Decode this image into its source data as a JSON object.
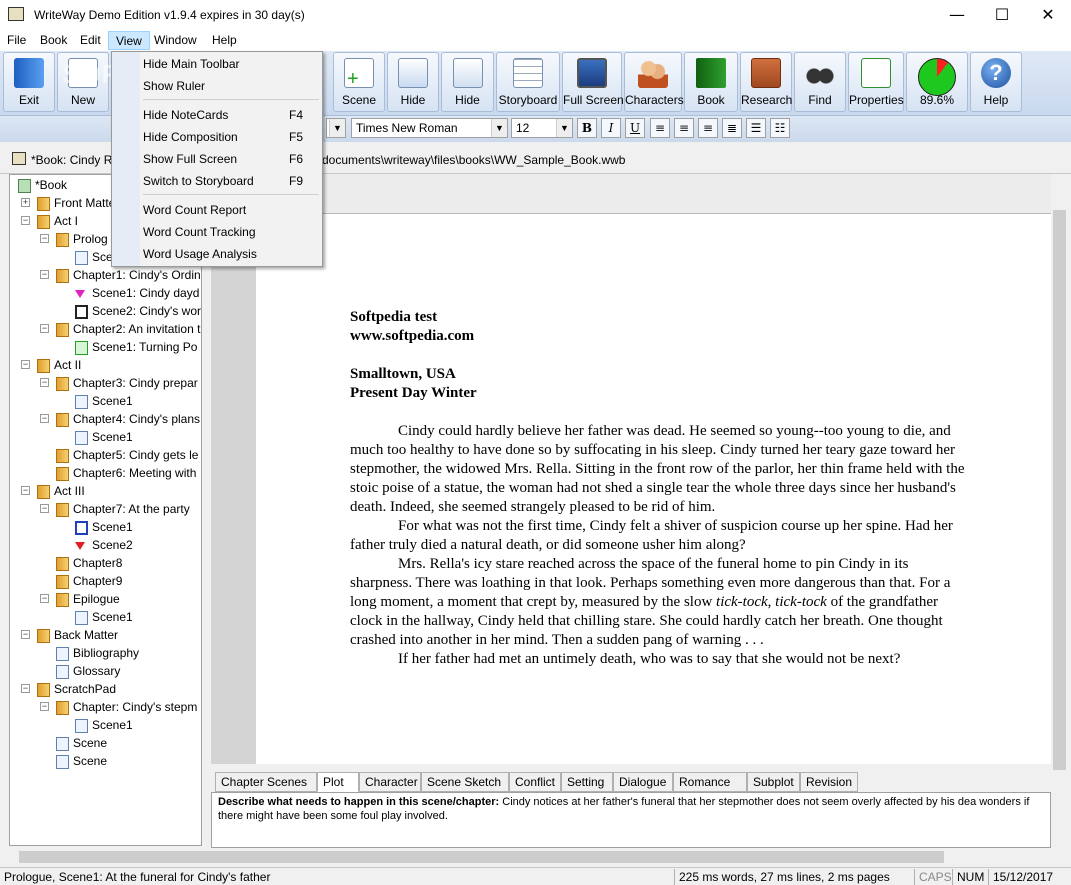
{
  "window": {
    "title": "WriteWay Demo Edition v1.9.4  expires in 30 day(s)",
    "min": "—",
    "max": "☐",
    "close": "✕"
  },
  "menubar": [
    "File",
    "Book",
    "Edit",
    "View",
    "Window",
    "Help"
  ],
  "toolbar": {
    "buttons": [
      "Exit",
      "New",
      "Scene",
      "Hide",
      "Hide",
      "Storyboard",
      "Full Screen",
      "Characters",
      "Book",
      "Research",
      "Find",
      "Properties",
      "89.6%",
      "Help"
    ],
    "watermark": "SOFTPEDIA"
  },
  "format": {
    "style": "",
    "font": "Times New Roman",
    "size": "12",
    "bold": "B",
    "italic": "I",
    "underline": "U"
  },
  "book_tab": {
    "label": "*Book: Cindy R",
    "path": "documents\\writeway\\files\\books\\WW_Sample_Book.wwb"
  },
  "view_menu": {
    "items": [
      {
        "label": "Hide Main Toolbar",
        "shortcut": ""
      },
      {
        "label": "Show Ruler",
        "shortcut": ""
      },
      {
        "label": "Hide NoteCards",
        "shortcut": "F4"
      },
      {
        "label": "Hide Composition",
        "shortcut": "F5"
      },
      {
        "label": "Show Full Screen",
        "shortcut": "F6"
      },
      {
        "label": "Switch to Storyboard",
        "shortcut": "F9"
      },
      {
        "label": "Word Count Report",
        "shortcut": ""
      },
      {
        "label": "Word Count Tracking",
        "shortcut": ""
      },
      {
        "label": "Word Usage Analysis",
        "shortcut": ""
      }
    ]
  },
  "tree": [
    {
      "label": "*Book",
      "icon": "book",
      "depth": 0
    },
    {
      "label": "Front Matte",
      "icon": "folder",
      "depth": 1,
      "exp": "+"
    },
    {
      "label": "Act I",
      "icon": "folder",
      "depth": 1,
      "exp": "−"
    },
    {
      "label": "Prolog",
      "icon": "folder",
      "depth": 2,
      "exp": "−"
    },
    {
      "label": "Sce",
      "icon": "scene",
      "depth": 3
    },
    {
      "label": "Chapter1: Cindy's Ordin",
      "icon": "folder",
      "depth": 2,
      "exp": "−"
    },
    {
      "label": "Scene1: Cindy dayd",
      "icon": "flag-magenta",
      "depth": 3
    },
    {
      "label": "Scene2: Cindy's wor",
      "icon": "scene-dark",
      "depth": 3
    },
    {
      "label": "Chapter2: An invitation t",
      "icon": "folder",
      "depth": 2,
      "exp": "−"
    },
    {
      "label": "Scene1: Turning Po",
      "icon": "scene-green",
      "depth": 3
    },
    {
      "label": "Act II",
      "icon": "folder",
      "depth": 1,
      "exp": "−"
    },
    {
      "label": "Chapter3: Cindy prepar",
      "icon": "folder",
      "depth": 2,
      "exp": "−"
    },
    {
      "label": "Scene1",
      "icon": "scene",
      "depth": 3
    },
    {
      "label": "Chapter4: Cindy's plans",
      "icon": "folder",
      "depth": 2,
      "exp": "−"
    },
    {
      "label": "Scene1",
      "icon": "scene",
      "depth": 3
    },
    {
      "label": "Chapter5: Cindy gets le",
      "icon": "folder",
      "depth": 2
    },
    {
      "label": "Chapter6: Meeting with",
      "icon": "folder",
      "depth": 2
    },
    {
      "label": "Act III",
      "icon": "folder",
      "depth": 1,
      "exp": "−"
    },
    {
      "label": "Chapter7: At the party",
      "icon": "folder",
      "depth": 2,
      "exp": "−"
    },
    {
      "label": "Scene1",
      "icon": "scene-blue",
      "depth": 3
    },
    {
      "label": "Scene2",
      "icon": "flag-red",
      "depth": 3
    },
    {
      "label": "Chapter8",
      "icon": "folder",
      "depth": 2
    },
    {
      "label": "Chapter9",
      "icon": "folder",
      "depth": 2
    },
    {
      "label": "Epilogue",
      "icon": "folder",
      "depth": 2,
      "exp": "−"
    },
    {
      "label": "Scene1",
      "icon": "scene",
      "depth": 3
    },
    {
      "label": "Back Matter",
      "icon": "folder",
      "depth": 1,
      "exp": "−"
    },
    {
      "label": "Bibliography",
      "icon": "scene",
      "depth": 2
    },
    {
      "label": "Glossary",
      "icon": "scene",
      "depth": 2
    },
    {
      "label": "ScratchPad",
      "icon": "pad",
      "depth": 1,
      "exp": "−"
    },
    {
      "label": "Chapter: Cindy's stepm",
      "icon": "folder",
      "depth": 2,
      "exp": "−"
    },
    {
      "label": "Scene1",
      "icon": "scene",
      "depth": 3
    },
    {
      "label": "Scene",
      "icon": "scene",
      "depth": 2
    },
    {
      "label": "Scene",
      "icon": "scene",
      "depth": 2
    }
  ],
  "document": {
    "heading1": "Softpedia test",
    "heading2": "www.softpedia.com",
    "heading3": "Smalltown, USA",
    "heading4": "Present Day Winter",
    "p1": "Cindy could hardly believe her father was dead. He seemed so young--too young to die, and much too healthy to have done so by suffocating in his sleep. Cindy turned her teary gaze toward her stepmother, the widowed Mrs. Rella. Sitting in the front row of the parlor, her thin frame held with the stoic poise of a statue, the woman had not shed a single tear the whole three days since her husband's death. Indeed, she seemed strangely pleased to be rid of him.",
    "p2": "For what was not the first time, Cindy felt a shiver of suspicion course up her spine. Had her father truly died a natural death, or did someone usher him along?",
    "p3a": "Mrs. Rella's icy stare reached across the space of the funeral home to pin Cindy in its sharpness. There was loathing in that look. Perhaps something even more dangerous than that. For a long moment, a moment that crept by, measured by the slow ",
    "p3i1": "tick-tock",
    "p3b": ", ",
    "p3i2": "tick-tock",
    "p3c": " of the grandfather clock in the hallway, Cindy held that chilling stare. She could hardly catch her breath. One thought crashed into another in her mind. Then a sudden pang of warning . . .",
    "p4": "If her father had met an untimely death, who was to say that she would not be next?"
  },
  "bottom_tabs": [
    "Chapter Scenes",
    "Plot",
    "Character",
    "Scene Sketch",
    "Conflict",
    "Setting",
    "Dialogue",
    "Romance",
    "Subplot",
    "Revision"
  ],
  "notes": {
    "label": "Describe what needs to happen in this scene/chapter:",
    "text": " Cindy notices at her father's funeral that her stepmother does not seem overly affected by his dea wonders if there might have been some foul play involved."
  },
  "status": {
    "location": "Prologue, Scene1: At the funeral for Cindy's father",
    "counts": "225 ms words, 27 ms lines, 2 ms pages",
    "caps": "CAPS",
    "num": "NUM",
    "date": "15/12/2017"
  },
  "colors": {
    "menu_highlight": "#cce8ff",
    "toolbar_bg": "#d6e3f3",
    "gauge_green": "#1ec81e",
    "gauge_red": "#ff2020"
  }
}
